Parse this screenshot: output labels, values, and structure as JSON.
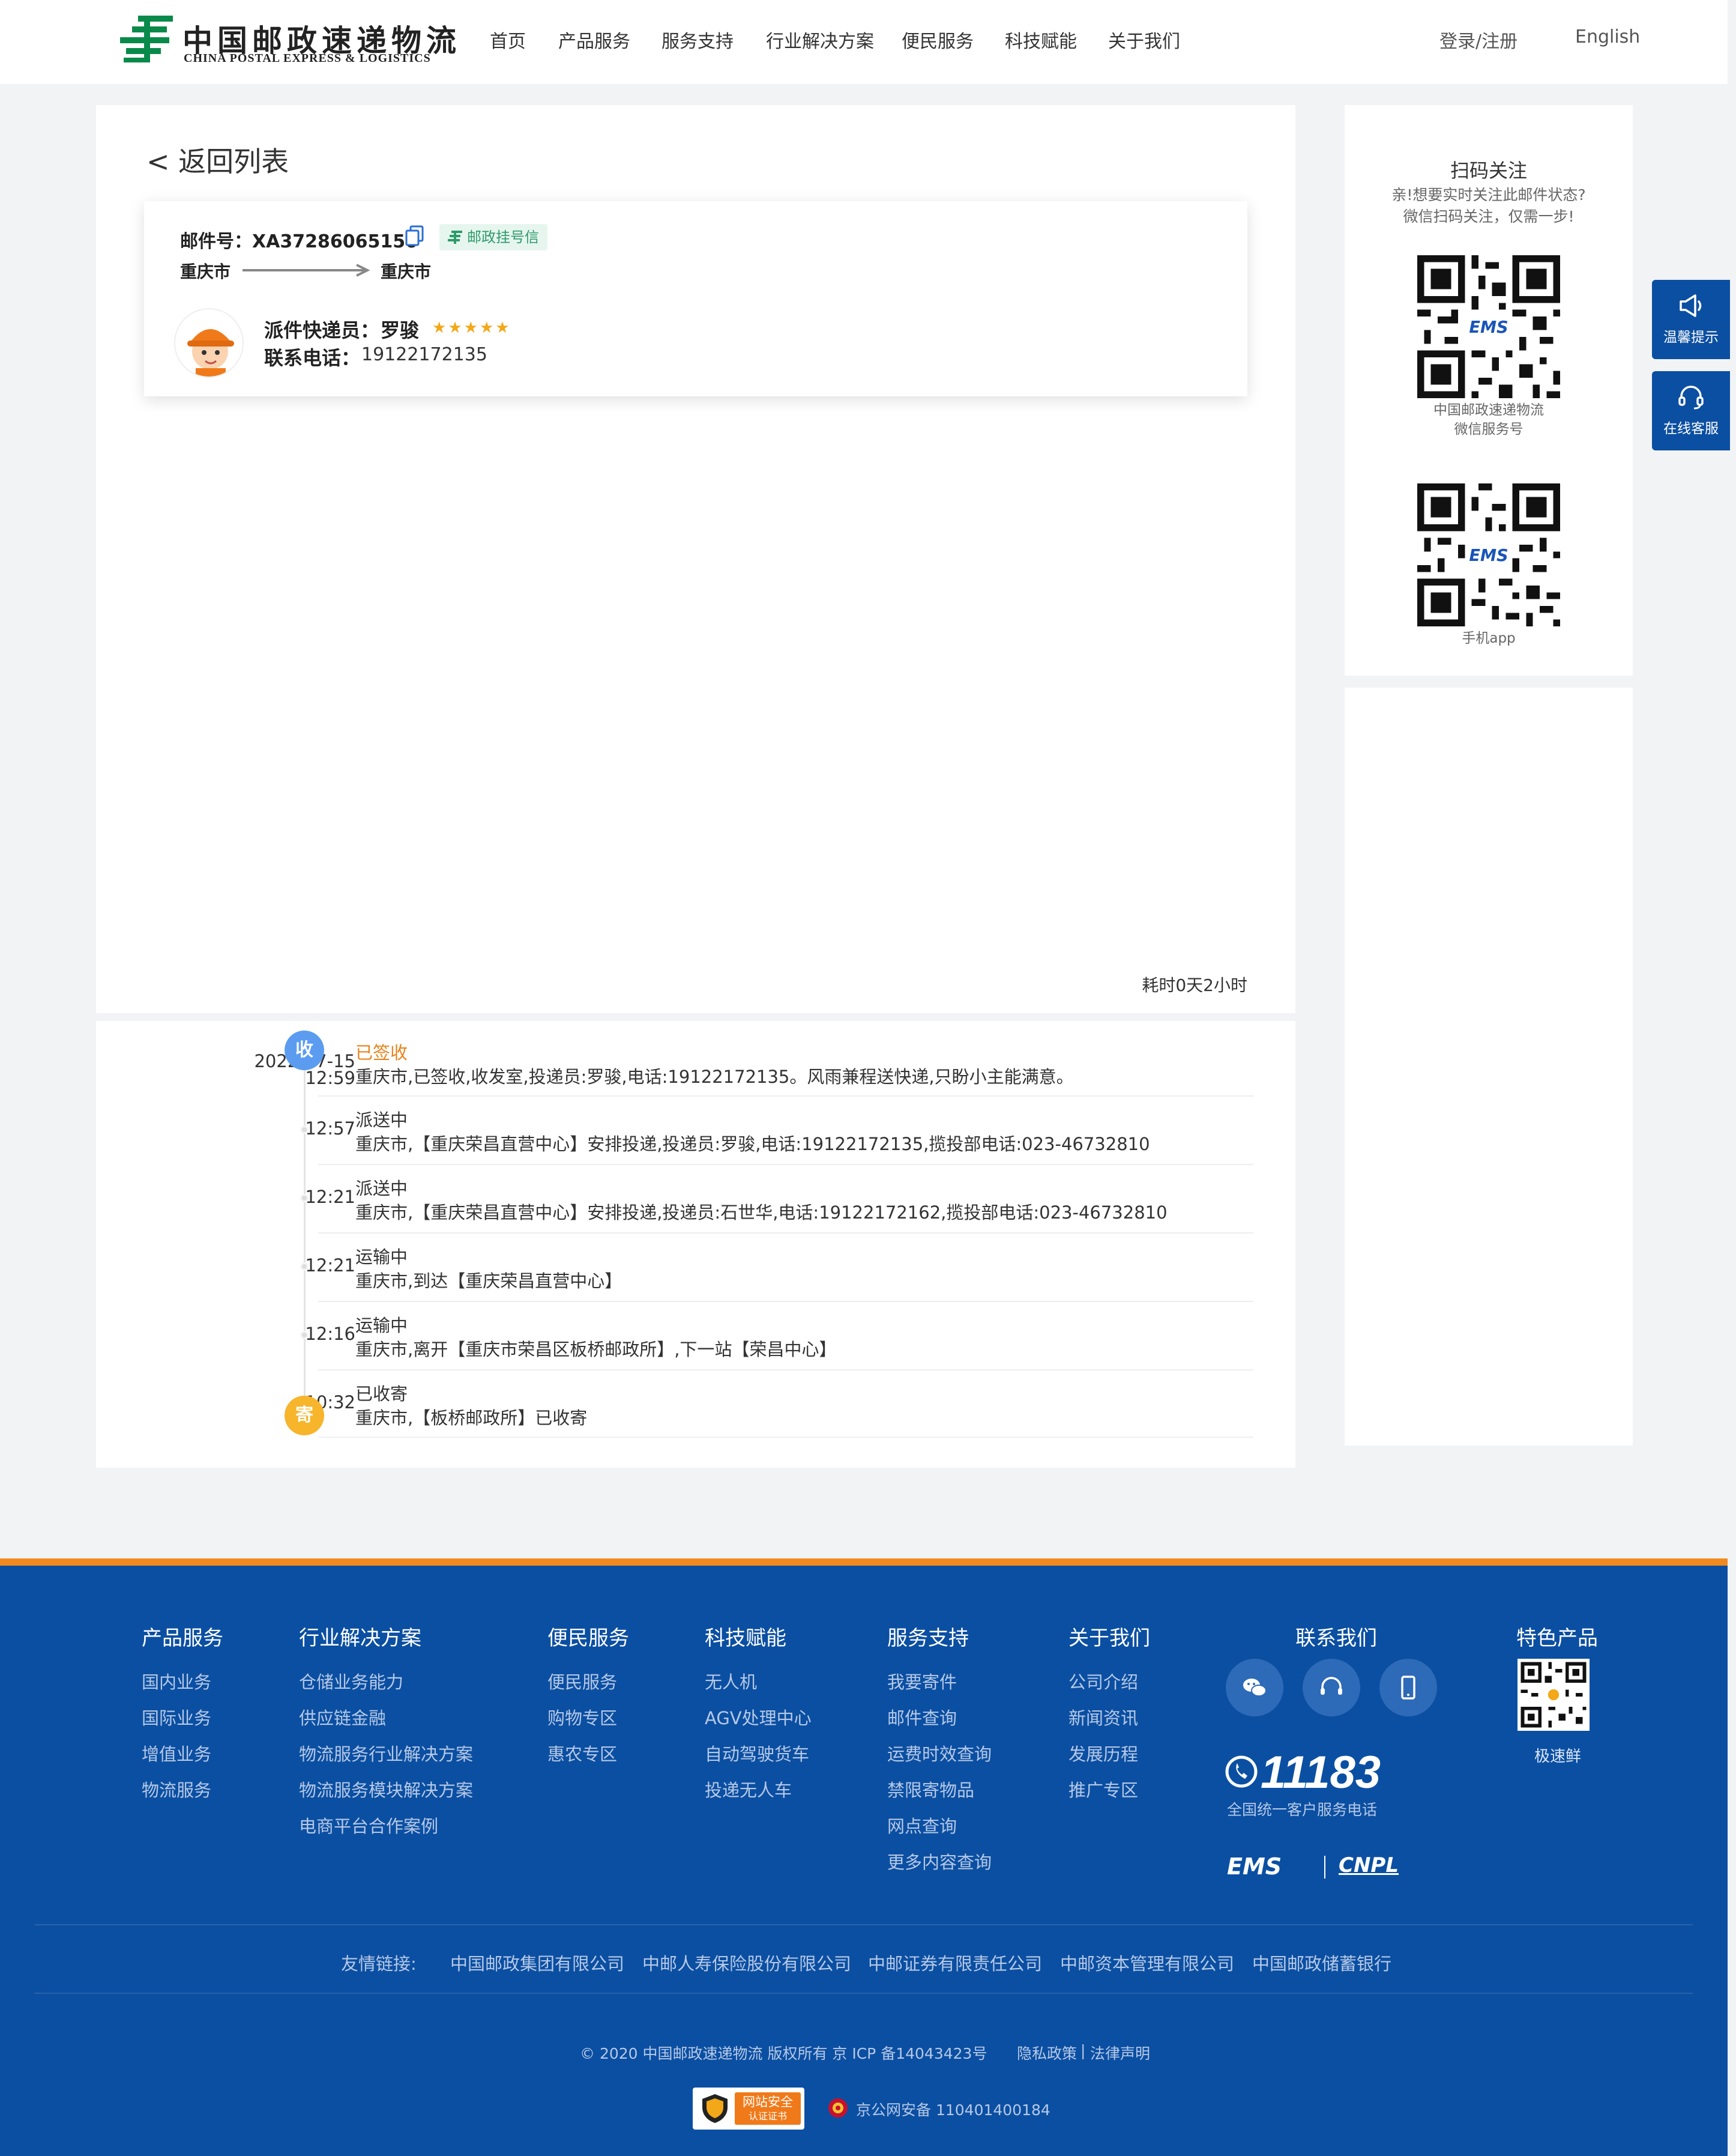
{
  "header": {
    "logo_cn": "中国邮政速递物流",
    "logo_en": "CHINA POSTAL EXPRESS & LOGISTICS",
    "nav": [
      "首页",
      "产品服务",
      "服务支持",
      "行业解决方案",
      "便民服务",
      "科技赋能",
      "关于我们"
    ],
    "login": "登录/注册",
    "language": "English"
  },
  "main": {
    "back_label": "< 返回列表",
    "card": {
      "mail_no_label": "邮件号：",
      "mail_no": "XA37286065150",
      "badge": "邮政挂号信",
      "from_city": "重庆市",
      "to_city": "重庆市",
      "courier_label": "派件快递员：",
      "courier_name": "罗骏",
      "courier_rating": 5,
      "phone_label": "联系电话：",
      "phone": "19122172135"
    },
    "duration": "耗时0天2小时"
  },
  "timeline": {
    "receive_node": "收",
    "send_node": "寄",
    "events": [
      {
        "date": "2022-07-15",
        "time": "12:59",
        "status": "已签收",
        "desc": "重庆市,已签收,收发室,投递员:罗骏,电话:19122172135。风雨兼程送快递,只盼小主能满意。"
      },
      {
        "date": "",
        "time": "12:57",
        "status": "派送中",
        "desc": "重庆市,【重庆荣昌直营中心】安排投递,投递员:罗骏,电话:19122172135,揽投部电话:023-46732810"
      },
      {
        "date": "",
        "time": "12:21",
        "status": "派送中",
        "desc": "重庆市,【重庆荣昌直营中心】安排投递,投递员:石世华,电话:19122172162,揽投部电话:023-46732810"
      },
      {
        "date": "",
        "time": "12:21",
        "status": "运输中",
        "desc": "重庆市,到达【重庆荣昌直营中心】"
      },
      {
        "date": "",
        "time": "12:16",
        "status": "运输中",
        "desc": "重庆市,离开【重庆市荣昌区板桥邮政所】,下一站【荣昌中心】"
      },
      {
        "date": "",
        "time": "10:32",
        "status": "已收寄",
        "desc": "重庆市,【板桥邮政所】已收寄"
      }
    ]
  },
  "sidebar": {
    "title": "扫码关注",
    "sub1": "亲!想要实时关注此邮件状态?",
    "sub2": "微信扫码关注，仅需一步!",
    "qr1_cap1": "中国邮政速递物流",
    "qr1_cap2": "微信服务号",
    "qr2_cap": "手机app",
    "qr_logo": "EMS"
  },
  "side_buttons": [
    "温馨提示",
    "在线客服"
  ],
  "footer": {
    "columns": [
      {
        "title": "产品服务",
        "links": [
          "国内业务",
          "国际业务",
          "增值业务",
          "物流服务"
        ]
      },
      {
        "title": "行业解决方案",
        "links": [
          "仓储业务能力",
          "供应链金融",
          "物流服务行业解决方案",
          "物流服务模块解决方案",
          "电商平台合作案例"
        ]
      },
      {
        "title": "便民服务",
        "links": [
          "便民服务",
          "购物专区",
          "惠农专区"
        ]
      },
      {
        "title": "科技赋能",
        "links": [
          "无人机",
          "AGV处理中心",
          "自动驾驶货车",
          "投递无人车"
        ]
      },
      {
        "title": "服务支持",
        "links": [
          "我要寄件",
          "邮件查询",
          "运费时效查询",
          "禁限寄物品",
          "网点查询",
          "更多内容查询"
        ]
      },
      {
        "title": "关于我们",
        "links": [
          "公司介绍",
          "新闻资讯",
          "发展历程",
          "推广专区"
        ]
      }
    ],
    "contact_title": "联系我们",
    "hotline": "11183",
    "hotline_sub": "全国统一客户服务电话",
    "brand_ems": "EMS",
    "brand_cnpl": "CNPL",
    "special_title": "特色产品",
    "special_caption": "极速鲜",
    "friend_label": "友情链接:",
    "friend_links": [
      "中国邮政集团有限公司",
      "中邮人寿保险股份有限公司",
      "中邮证券有限责任公司",
      "中邮资本管理有限公司",
      "中国邮政储蓄银行"
    ],
    "copyright": "© 2020 中国邮政速递物流 版权所有 京 ICP 备14043423号",
    "privacy": "隐私政策",
    "legal": "法律声明",
    "cert_line1": "网站安全",
    "cert_line2": "认证证书",
    "police": "京公网安备 110401400184"
  },
  "colors": {
    "brand_blue": "#0b4fa2",
    "accent_orange": "#f28a1d",
    "signed_orange": "#e8831b",
    "receive_node": "#5b9cf0",
    "send_node": "#f7b52c",
    "star": "#f2a818",
    "badge_green": "#2f9a6a"
  }
}
